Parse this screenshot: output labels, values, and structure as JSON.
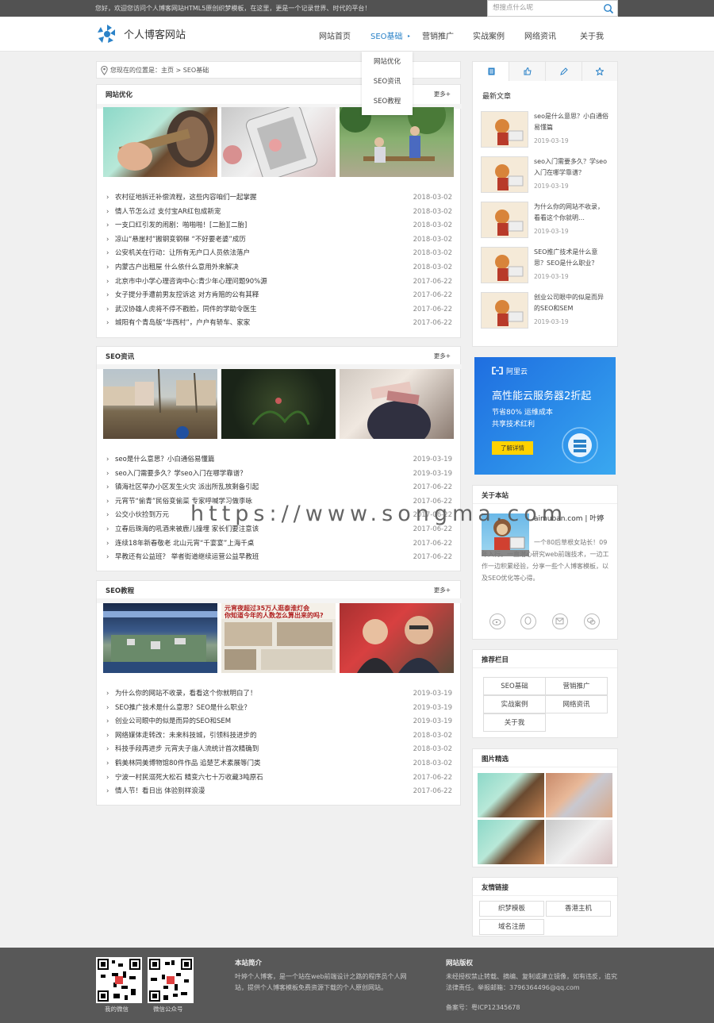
{
  "topbar": {
    "greeting": "您好，欢迎您访问个人博客网站HTML5原创织梦模板，在这里，更是一个记录世界、时代的平台！",
    "search_placeholder": "想搜点什么呢"
  },
  "header": {
    "site_name": "个人博客网站"
  },
  "nav": [
    {
      "label": "网站首页"
    },
    {
      "label": "SEO基础"
    },
    {
      "label": "营销推广"
    },
    {
      "label": "实战案例"
    },
    {
      "label": "网络资讯"
    },
    {
      "label": "关于我"
    }
  ],
  "dropdown": [
    "网站优化",
    "SEO资讯",
    "SEO教程"
  ],
  "breadcrumb": "您现在的位置是：主页 > SEO基础",
  "more_label": "更多+",
  "sections": [
    {
      "title": "网站优化",
      "items": [
        {
          "title": "农村征地拆迁补偿流程，这些内容咱们一起掌握",
          "date": "2018-03-02"
        },
        {
          "title": "情人节怎么过 支付宝AR红包成新宠",
          "date": "2018-03-02"
        },
        {
          "title": "一支口红引发的闹剧：啪啪啪！[二胎][二胎]",
          "date": "2018-03-02"
        },
        {
          "title": "凉山“悬崖村”搬钢变钢梯 “不好要老婆”成历",
          "date": "2018-03-02"
        },
        {
          "title": "公安机关在行动：让所有无户口人员依法落户",
          "date": "2018-03-02"
        },
        {
          "title": "内蒙古户出租屋 什么依什么意用外来解决",
          "date": "2018-03-02"
        },
        {
          "title": "北京市中小学心理咨询中心:青少年心理问题90%源",
          "date": "2017-06-22"
        },
        {
          "title": "女子提分手遭前男友控诉这 对方肯赔的公有其释",
          "date": "2017-06-22"
        },
        {
          "title": "武汉协雄人虎将不停不戳脸，同件的学助令医生",
          "date": "2017-06-22"
        },
        {
          "title": "城阳有个青岛版“华西村”，户户有轿车、家家",
          "date": "2017-06-22"
        }
      ]
    },
    {
      "title": "SEO资讯",
      "items": [
        {
          "title": "seo是什么意思？小白通俗易懂篇",
          "date": "2019-03-19"
        },
        {
          "title": "seo入门需要多久？学seo入门在哪学靠谱？",
          "date": "2019-03-19"
        },
        {
          "title": "镇海社区举办小区发生火灾 派出所乱放剩备引起",
          "date": "2017-06-22"
        },
        {
          "title": "元宵节“偷青”民俗变偷菜 专家呼喊学习做李咏",
          "date": "2017-06-22"
        },
        {
          "title": "公交小伙捡到万元",
          "date": "2017-06-22"
        },
        {
          "title": "立春后珠海的吼酒来被鹿儿撞埋 家长们要注意该",
          "date": "2017-06-22"
        },
        {
          "title": "连续18年新春敬老 北山元宵“千宴宴”上海千桌",
          "date": "2017-06-22"
        },
        {
          "title": "早教还有公益班？ 举者街道继续运营公益早教班",
          "date": "2017-06-22"
        }
      ]
    },
    {
      "title": "SEO教程",
      "items": [
        {
          "title": "为什么你的网站不收录，看看这个你就明白了！",
          "date": "2019-03-19"
        },
        {
          "title": "SEO推广技术是什么意思？SEO是什么职业？",
          "date": "2019-03-19"
        },
        {
          "title": "创业公司眼中的似是而异的SEO和SEM",
          "date": "2019-03-19"
        },
        {
          "title": "网络媒体走转改：未来科技城，引领科技进步的",
          "date": "2018-03-02"
        },
        {
          "title": "科技手段再进步 元宵夫子庙人流统计首次精确到",
          "date": "2018-03-02"
        },
        {
          "title": "鹤美林同美博物馆80件作品 追楚艺术素展等门类",
          "date": "2018-03-02"
        },
        {
          "title": "宁波一村民溺死大松石 精变六七十万收藏3吨原石",
          "date": "2017-06-22"
        },
        {
          "title": "情人节！看日出 体验别样浪漫",
          "date": "2017-06-22"
        }
      ]
    }
  ],
  "sidebar": {
    "latest_title": "最新文章",
    "latest": [
      {
        "title": "seo是什么意思？小白通俗易懂篇",
        "date": "2019-03-19"
      },
      {
        "title": "seo入门需要多久？学seo入门在哪学靠谱？",
        "date": "2019-03-19"
      },
      {
        "title": "为什么你的网站不收录，看看这个你就明…",
        "date": "2019-03-19"
      },
      {
        "title": "SEO推广技术是什么意思？SEO是什么职业？",
        "date": "2019-03-19"
      },
      {
        "title": "创业公司眼中的似是而异的SEO和SEM",
        "date": "2019-03-19"
      }
    ],
    "ad": {
      "brand": "阿里云",
      "headline": "高性能云服务器2折起",
      "sub1": "节省80% 运维成本",
      "sub2": "共享技术红利",
      "button": "了解详情"
    },
    "about": {
      "title": "关于本站",
      "site": "aimuban.com | 叶婷",
      "desc": "一个80后草根女站长！09年入行。一直潜心研究web前端技术，一边工作一边积累经验，分享一些个人博客模板，以及SEO优化等心得。"
    },
    "recommend": {
      "title": "推荐栏目",
      "items": [
        "SEO基础",
        "营销推广",
        "实战案例",
        "网络资讯",
        "关于我"
      ]
    },
    "pics_title": "图片精选",
    "links": {
      "title": "友情链接",
      "items": [
        "织梦模板",
        "香港主机",
        "域名注册"
      ]
    }
  },
  "watermark": "https://www.songma.com",
  "footer": {
    "qr1": "我的微信",
    "qr2": "微信公众号",
    "intro_title": "本站简介",
    "intro": "叶婷个人博客，是一个站在web前端设计之路的程序员个人网站，提供个人博客模板免费资源下载的个人原创网站。",
    "copy_title": "网站版权",
    "copy": "未经授权禁止转载、摘编、复制或建立镜像，如有违反，追究法律责任。举报邮箱：3796364496@qq.com",
    "icp": "备案号：粤ICP12345678"
  },
  "colors": {
    "accent": "#2a82c8",
    "topbar": "#525252",
    "footer": "#585858"
  }
}
